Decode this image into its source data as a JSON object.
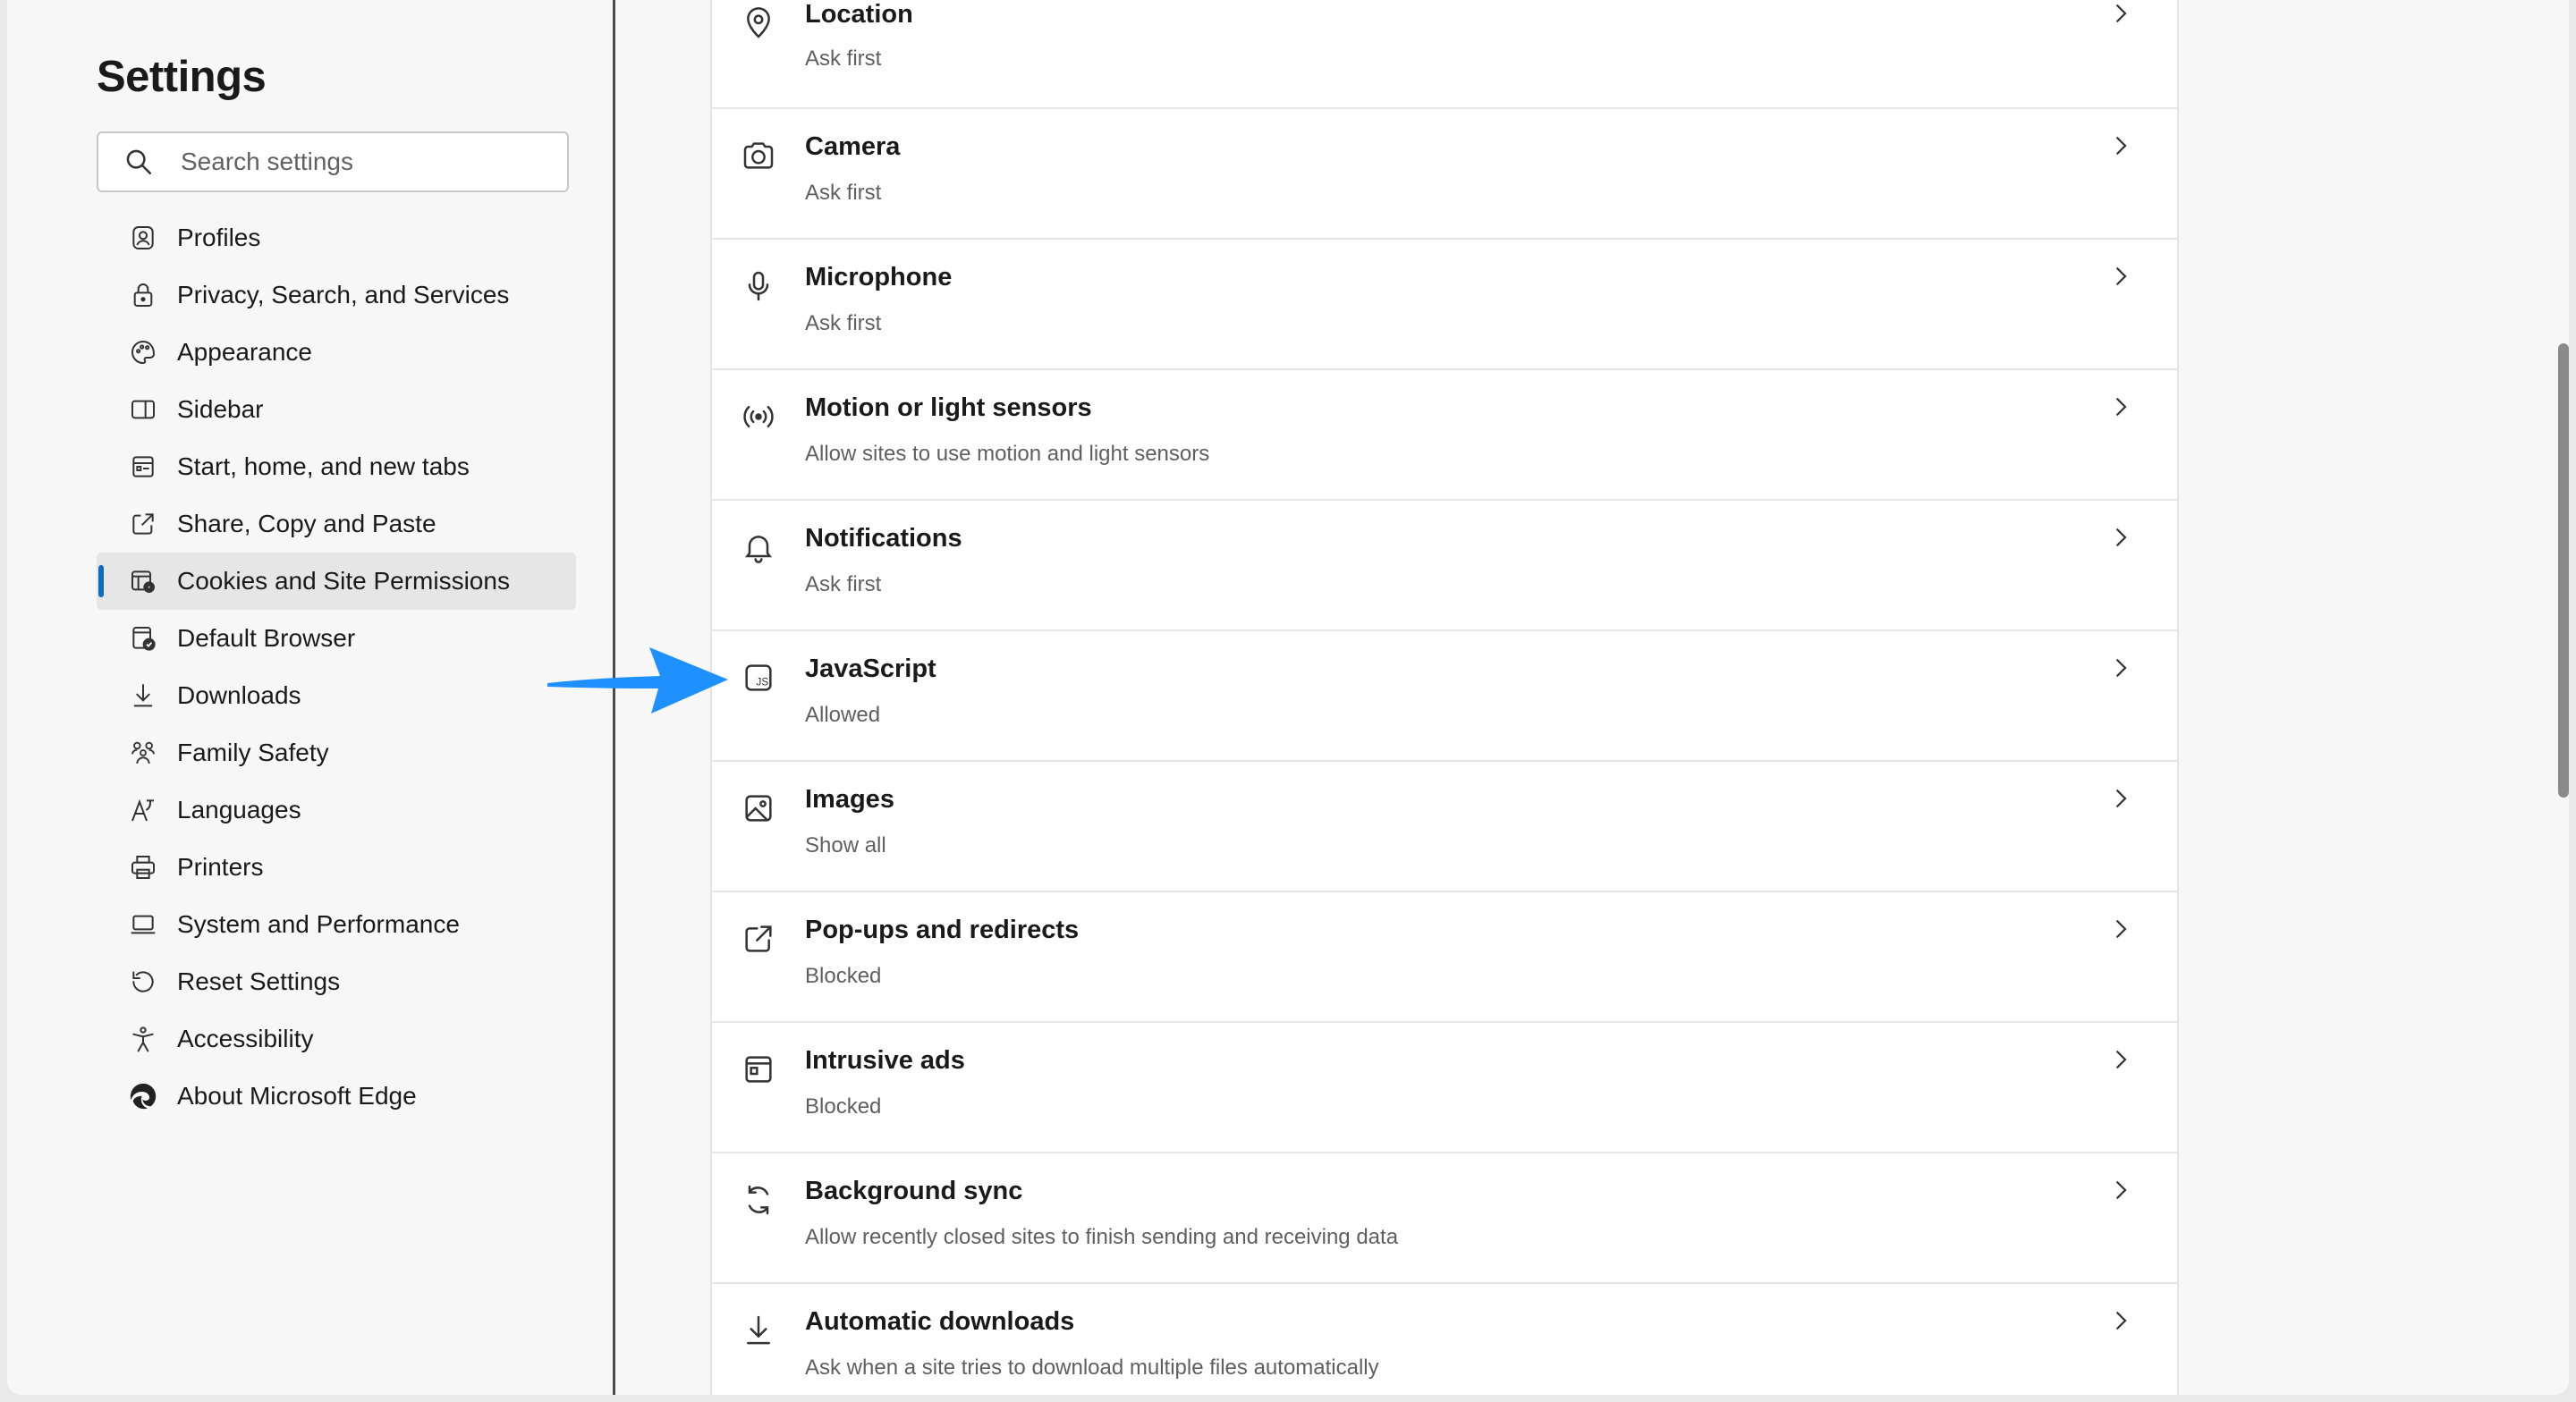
{
  "sidebar": {
    "title": "Settings",
    "search_placeholder": "Search settings",
    "items": [
      {
        "label": "Profiles",
        "icon": "profile-icon"
      },
      {
        "label": "Privacy, Search, and Services",
        "icon": "lock-icon"
      },
      {
        "label": "Appearance",
        "icon": "palette-icon"
      },
      {
        "label": "Sidebar",
        "icon": "sidebar-icon"
      },
      {
        "label": "Start, home, and new tabs",
        "icon": "home-tabs-icon"
      },
      {
        "label": "Share, Copy and Paste",
        "icon": "share-icon"
      },
      {
        "label": "Cookies and Site Permissions",
        "icon": "cookies-icon",
        "active": true
      },
      {
        "label": "Default Browser",
        "icon": "default-browser-icon"
      },
      {
        "label": "Downloads",
        "icon": "download-icon"
      },
      {
        "label": "Family Safety",
        "icon": "family-icon"
      },
      {
        "label": "Languages",
        "icon": "languages-icon"
      },
      {
        "label": "Printers",
        "icon": "printer-icon"
      },
      {
        "label": "System and Performance",
        "icon": "laptop-icon"
      },
      {
        "label": "Reset Settings",
        "icon": "reset-icon"
      },
      {
        "label": "Accessibility",
        "icon": "accessibility-icon"
      },
      {
        "label": "About Microsoft Edge",
        "icon": "edge-logo-icon"
      }
    ]
  },
  "permissions": [
    {
      "title": "Location",
      "subtitle": "Ask first",
      "icon": "location-icon"
    },
    {
      "title": "Camera",
      "subtitle": "Ask first",
      "icon": "camera-icon"
    },
    {
      "title": "Microphone",
      "subtitle": "Ask first",
      "icon": "microphone-icon"
    },
    {
      "title": "Motion or light sensors",
      "subtitle": "Allow sites to use motion and light sensors",
      "icon": "sensor-icon"
    },
    {
      "title": "Notifications",
      "subtitle": "Ask first",
      "icon": "bell-icon"
    },
    {
      "title": "JavaScript",
      "subtitle": "Allowed",
      "icon": "javascript-icon"
    },
    {
      "title": "Images",
      "subtitle": "Show all",
      "icon": "image-icon"
    },
    {
      "title": "Pop-ups and redirects",
      "subtitle": "Blocked",
      "icon": "popup-icon"
    },
    {
      "title": "Intrusive ads",
      "subtitle": "Blocked",
      "icon": "ads-icon"
    },
    {
      "title": "Background sync",
      "subtitle": "Allow recently closed sites to finish sending and receiving data",
      "icon": "sync-icon"
    },
    {
      "title": "Automatic downloads",
      "subtitle": "Ask when a site tries to download multiple files automatically",
      "icon": "download-icon"
    }
  ],
  "colors": {
    "accent": "#0f6cbd",
    "annotation_arrow": "#1e90ff"
  }
}
